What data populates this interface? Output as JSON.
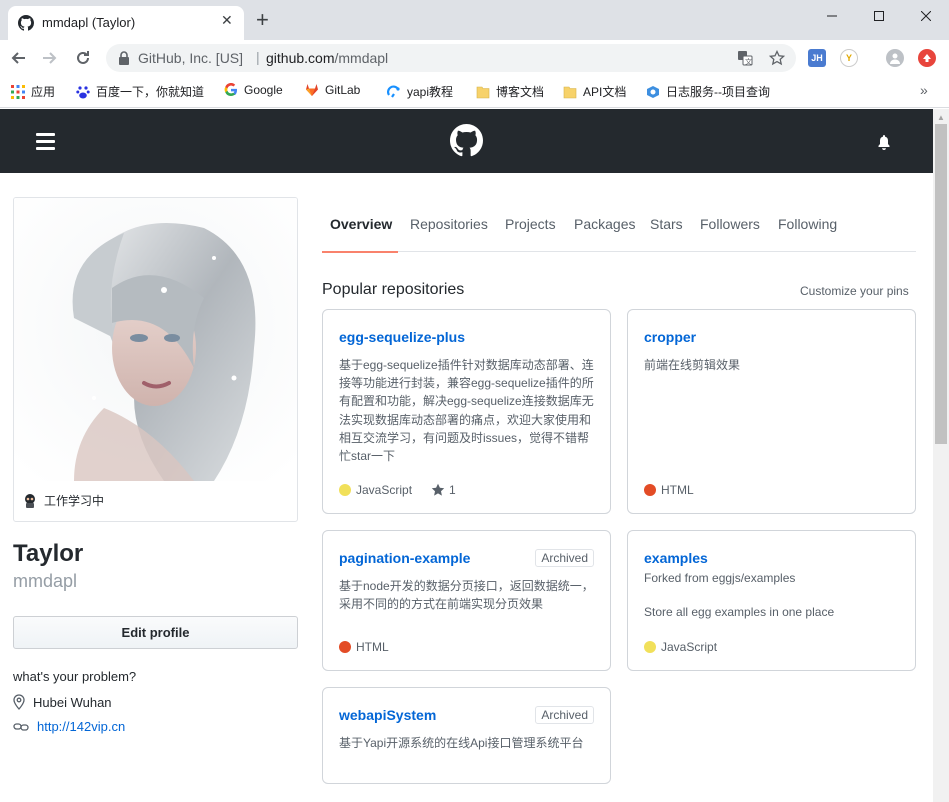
{
  "browser": {
    "tab_title": "mmdapl (Taylor)",
    "address": {
      "org": "GitHub, Inc. [US]",
      "host": "github.com",
      "path": "/mmdapl"
    },
    "extensions": [
      "JH",
      "Y"
    ],
    "bookmarks": [
      {
        "label": "应用",
        "icon": "apps-grid-icon"
      },
      {
        "label": "百度一下，你就知道",
        "icon": "baidu-icon"
      },
      {
        "label": "Google",
        "icon": "google-icon"
      },
      {
        "label": "GitLab",
        "icon": "gitlab-icon"
      },
      {
        "label": "yapi教程",
        "icon": "yapi-icon"
      },
      {
        "label": "博客文档",
        "icon": "folder-icon"
      },
      {
        "label": "API文档",
        "icon": "folder-icon"
      },
      {
        "label": "日志服务--项目查询",
        "icon": "log-service-icon"
      }
    ],
    "bookmarks_more": "»"
  },
  "profile": {
    "status": "工作学习中",
    "name": "Taylor",
    "login": "mmdapl",
    "edit_button": "Edit profile",
    "bio": "what's your problem?",
    "location": "Hubei Wuhan",
    "website": "http://142vip.cn"
  },
  "tabs": [
    "Overview",
    "Repositories",
    "Projects",
    "Packages",
    "Stars",
    "Followers",
    "Following"
  ],
  "selected_tab": "Overview",
  "pinned": {
    "title": "Popular repositories",
    "customize": "Customize your pins",
    "repos": [
      {
        "name": "egg-sequelize-plus",
        "badge": "",
        "forked_from": "",
        "description": "基于egg-sequelize插件针对数据库动态部署、连接等功能进行封装，兼容egg-sequelize插件的所有配置和功能，解决egg-sequelize连接数据库无法实现数据库动态部署的痛点，欢迎大家使用和相互交流学习，有问题及时issues，觉得不错帮忙star一下",
        "language": "JavaScript",
        "language_color": "#f1e05a",
        "stars": "1"
      },
      {
        "name": "cropper",
        "badge": "",
        "forked_from": "",
        "description": "前端在线剪辑效果",
        "language": "HTML",
        "language_color": "#e34c26",
        "stars": ""
      },
      {
        "name": "pagination-example",
        "badge": "Archived",
        "forked_from": "",
        "description": "基于node开发的数据分页接口，返回数据统一，采用不同的的方式在前端实现分页效果",
        "language": "HTML",
        "language_color": "#e34c26",
        "stars": ""
      },
      {
        "name": "examples",
        "badge": "",
        "forked_from": "Forked from eggjs/examples",
        "description": "Store all egg examples in one place",
        "language": "JavaScript",
        "language_color": "#f1e05a",
        "stars": ""
      },
      {
        "name": "webapiSystem",
        "badge": "Archived",
        "forked_from": "",
        "description": "基于Yapi开源系统的在线Api接口管理系统平台",
        "language": "",
        "language_color": "",
        "stars": ""
      }
    ]
  }
}
